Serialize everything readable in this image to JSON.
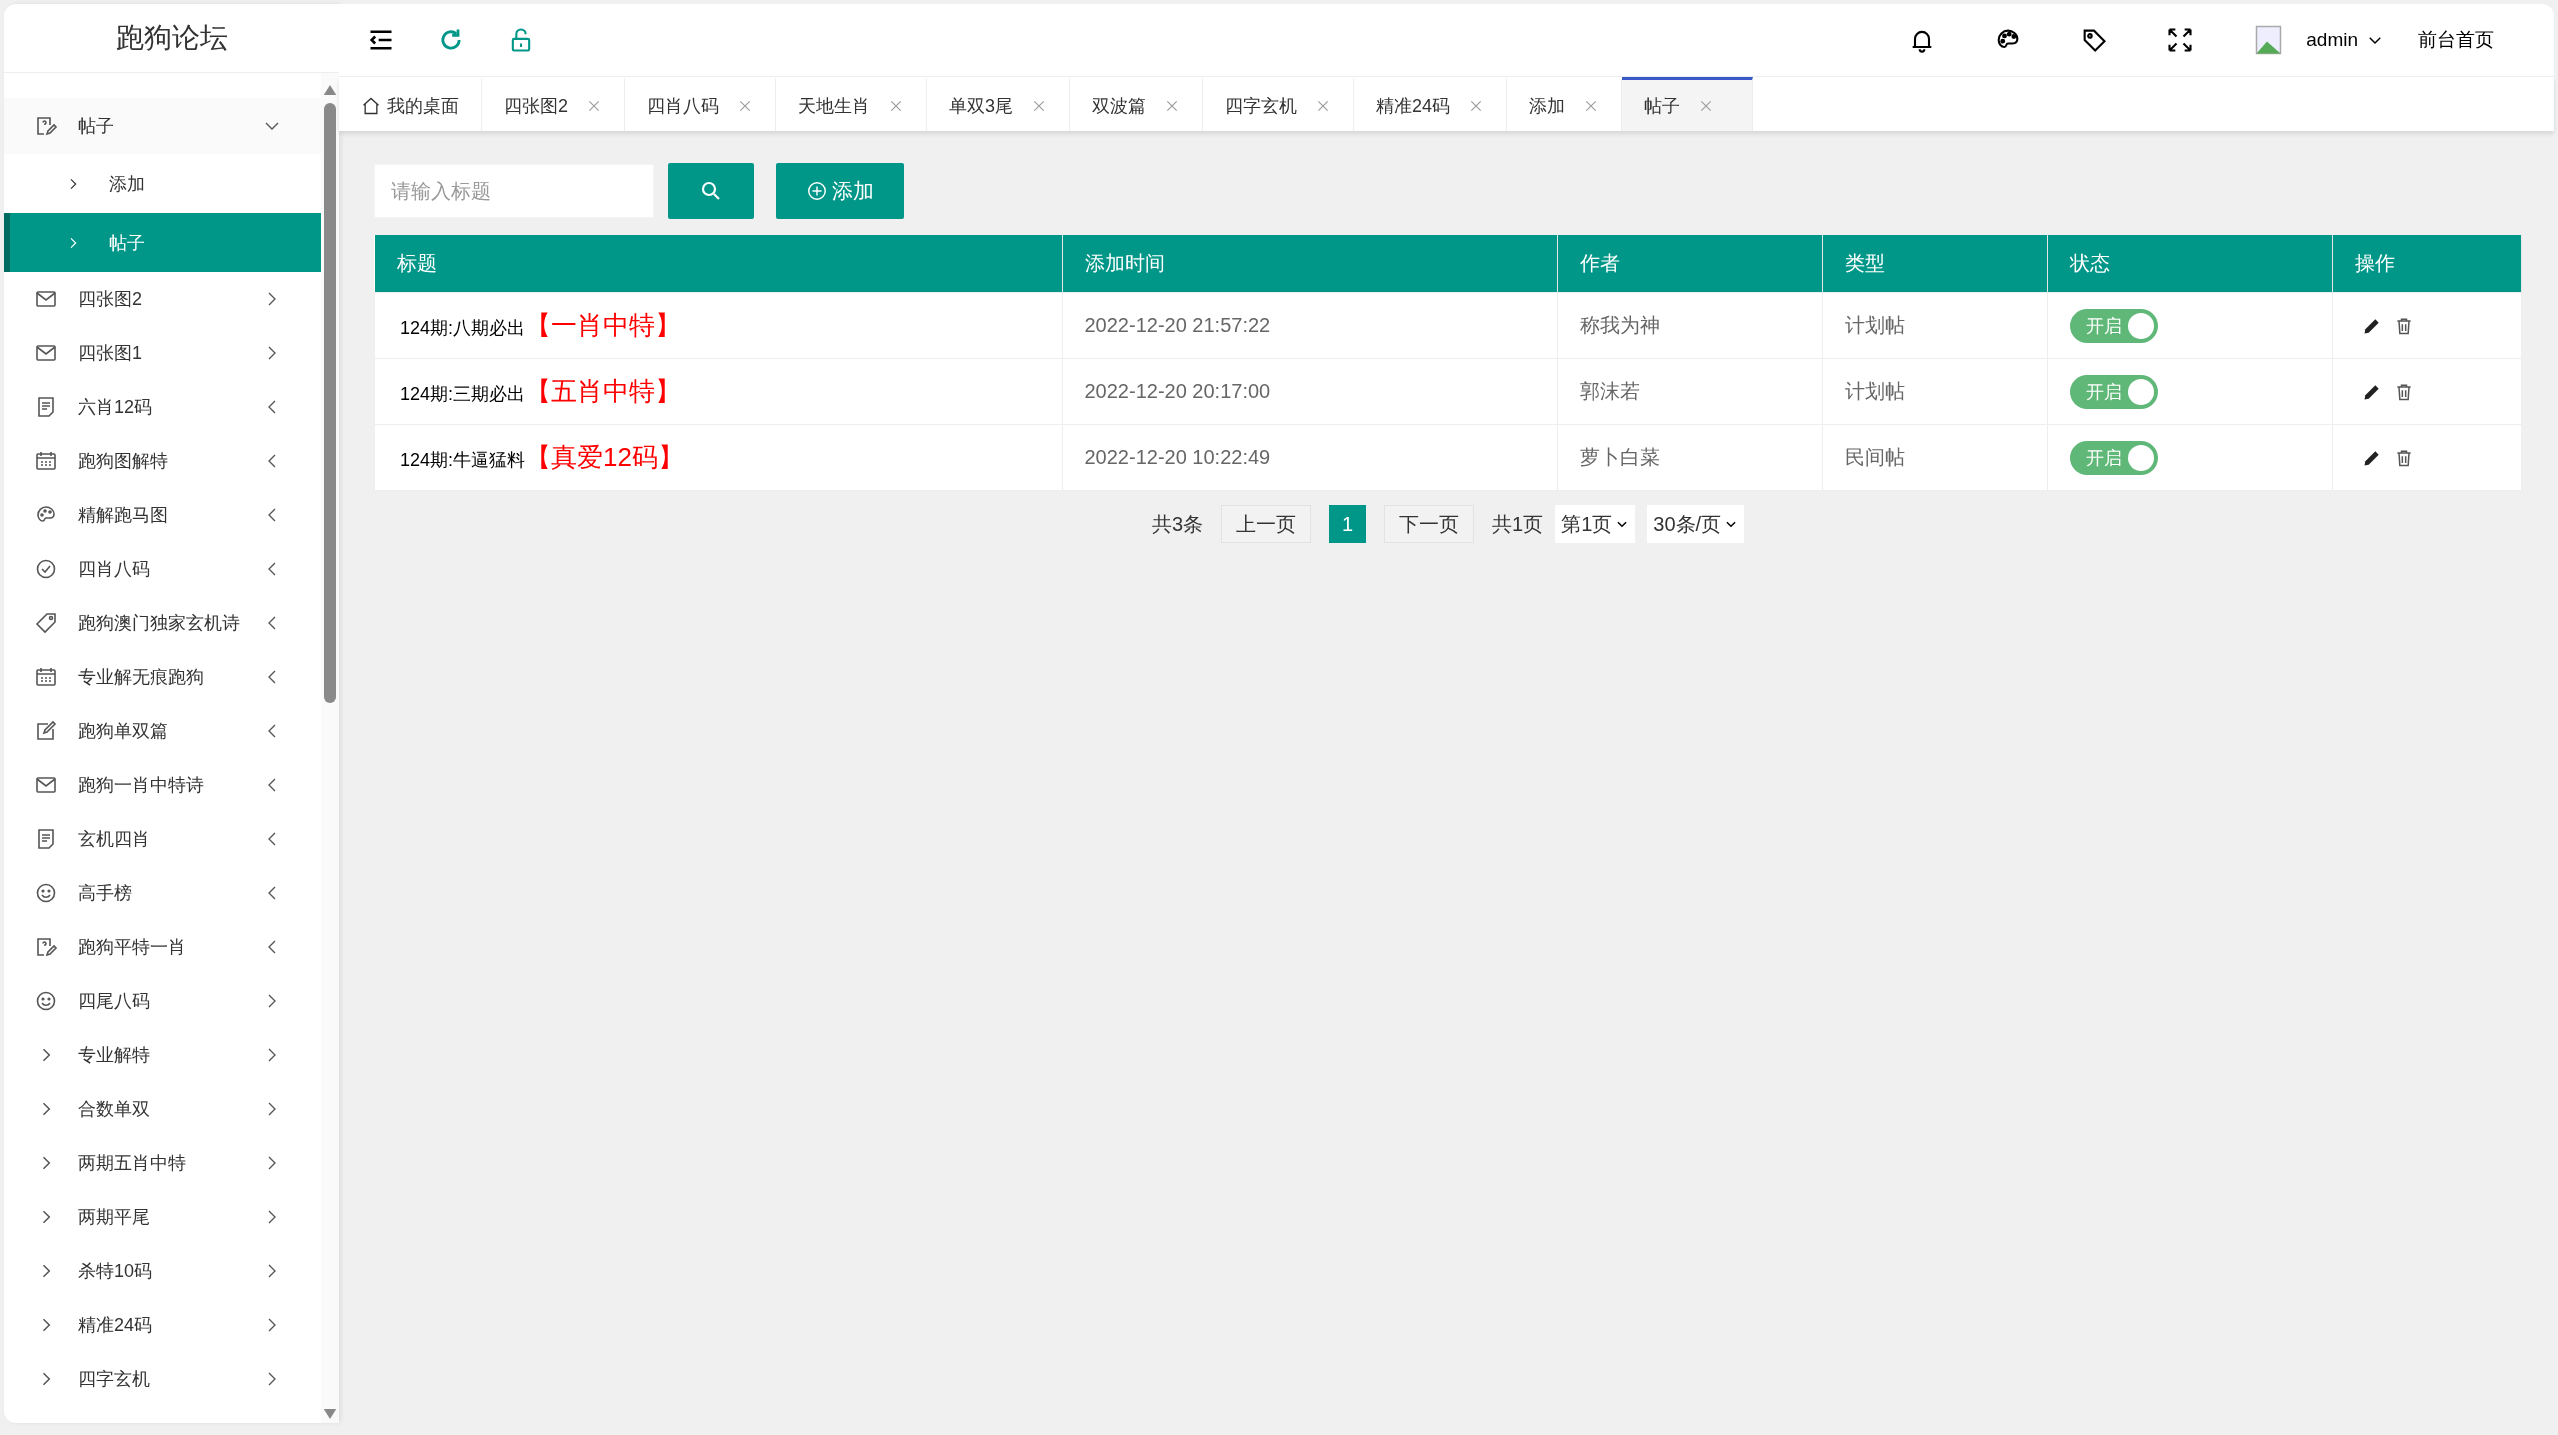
{
  "logo": "跑狗论坛",
  "sidebar": {
    "items": [
      {
        "label": "帖子",
        "kind": "note-edit",
        "expanded": true,
        "children": [
          {
            "label": "添加",
            "selected": false
          },
          {
            "label": "帖子",
            "selected": true
          }
        ]
      },
      {
        "label": "四张图2",
        "kind": "mail",
        "arrow_left": false,
        "expanded": false
      },
      {
        "label": "四张图1",
        "kind": "mail",
        "arrow_left": false,
        "expanded": false
      },
      {
        "label": "六肖12码",
        "kind": "doc",
        "arrow_left": true,
        "expanded": false
      },
      {
        "label": "跑狗图解特",
        "kind": "calendar",
        "arrow_left": true,
        "expanded": false
      },
      {
        "label": "精解跑马图",
        "kind": "palette",
        "arrow_left": true,
        "expanded": false
      },
      {
        "label": "四肖八码",
        "kind": "check",
        "arrow_left": true,
        "expanded": false
      },
      {
        "label": "跑狗澳门独家玄机诗",
        "kind": "tag",
        "arrow_left": true,
        "expanded": false
      },
      {
        "label": "专业解无痕跑狗",
        "kind": "calendar",
        "arrow_left": true,
        "expanded": false
      },
      {
        "label": "跑狗单双篇",
        "kind": "edit",
        "arrow_left": true,
        "expanded": false
      },
      {
        "label": "跑狗一肖中特诗",
        "kind": "mail",
        "arrow_left": true,
        "expanded": false
      },
      {
        "label": "玄机四肖",
        "kind": "doc",
        "arrow_left": true,
        "expanded": false
      },
      {
        "label": "高手榜",
        "kind": "smile",
        "arrow_left": true,
        "expanded": false
      },
      {
        "label": "跑狗平特一肖",
        "kind": "note-edit",
        "arrow_left": true,
        "expanded": false
      },
      {
        "label": "四尾八码",
        "kind": "smile",
        "arrow_left": false,
        "expanded": false
      },
      {
        "label": "专业解特",
        "kind": "chevron",
        "arrow_left": false,
        "expanded": false
      },
      {
        "label": "合数单双",
        "kind": "chevron",
        "arrow_left": false,
        "expanded": false
      },
      {
        "label": "两期五肖中特",
        "kind": "chevron",
        "arrow_left": false,
        "expanded": false
      },
      {
        "label": "两期平尾",
        "kind": "chevron",
        "arrow_left": false,
        "expanded": false
      },
      {
        "label": "杀特10码",
        "kind": "chevron",
        "arrow_left": false,
        "expanded": false
      },
      {
        "label": "精准24码",
        "kind": "chevron",
        "arrow_left": false,
        "expanded": false
      },
      {
        "label": "四字玄机",
        "kind": "chevron",
        "arrow_left": false,
        "expanded": false
      }
    ]
  },
  "header": {
    "user": "admin",
    "link": "前台首页"
  },
  "tabs": [
    {
      "label": "我的桌面",
      "kind": "home",
      "selected": false
    },
    {
      "label": "四张图2",
      "kind": "page",
      "selected": false
    },
    {
      "label": "四肖八码",
      "kind": "page",
      "selected": false
    },
    {
      "label": "天地生肖",
      "kind": "page",
      "selected": false
    },
    {
      "label": "单双3尾",
      "kind": "page",
      "selected": false
    },
    {
      "label": "双波篇",
      "kind": "page",
      "selected": false
    },
    {
      "label": "四字玄机",
      "kind": "page",
      "selected": false
    },
    {
      "label": "精准24码",
      "kind": "page",
      "selected": false
    },
    {
      "label": "添加",
      "kind": "page",
      "selected": false
    },
    {
      "label": "帖子",
      "kind": "page",
      "selected": true
    }
  ],
  "search": {
    "placeholder": "请输入标题"
  },
  "add_button": "添加",
  "table": {
    "columns": [
      "标题",
      "添加时间",
      "作者",
      "类型",
      "状态",
      "操作"
    ],
    "rows": [
      {
        "title": "124期:八期必出",
        "highlight": "【一肖中特】",
        "time": "2022-12-20 21:57:22",
        "author": "称我为神",
        "type": "计划帖",
        "status": {
          "label": "开启",
          "on": true
        }
      },
      {
        "title": "124期:三期必出",
        "highlight": "【五肖中特】",
        "time": "2022-12-20 20:17:00",
        "author": "郭沫若",
        "type": "计划帖",
        "status": {
          "label": "开启",
          "on": true
        }
      },
      {
        "title": "124期:牛逼猛料",
        "highlight": "【真爱12码】",
        "time": "2022-12-20 10:22:49",
        "author": "萝卜白菜",
        "type": "民间帖",
        "status": {
          "label": "开启",
          "on": true
        }
      }
    ]
  },
  "pagination": {
    "total": "共3条",
    "prev": "上一页",
    "pages": [
      {
        "label": "1",
        "selected": true
      }
    ],
    "next": "下一页",
    "page_count": "共1页",
    "page_select": "第1页",
    "size_select": "30条/页"
  }
}
